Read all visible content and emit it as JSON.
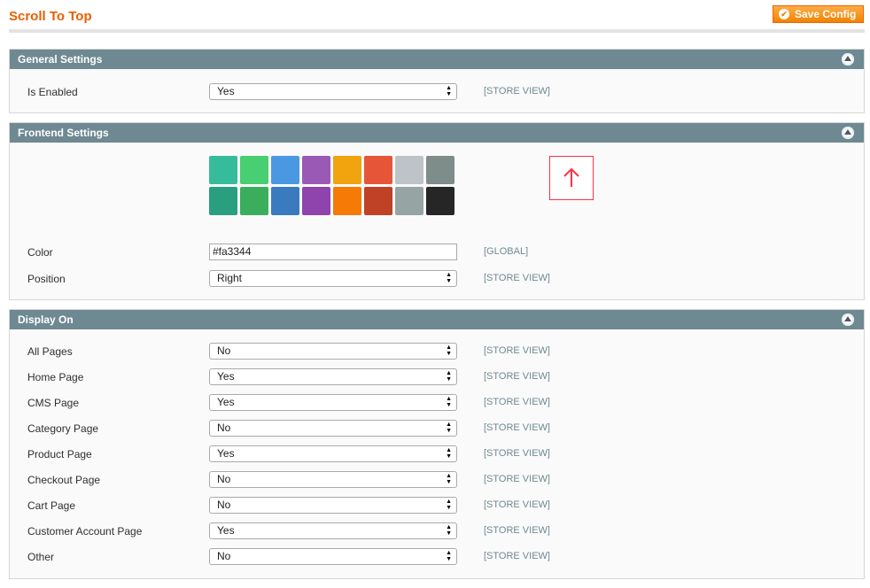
{
  "page": {
    "title": "Scroll To Top",
    "save_button": "Save Config"
  },
  "general": {
    "title": "General Settings",
    "is_enabled": {
      "label": "Is Enabled",
      "value": "Yes",
      "scope": "[STORE VIEW]"
    }
  },
  "frontend": {
    "title": "Frontend Settings",
    "swatches": [
      "#36bc9b",
      "#48cf71",
      "#4b98e2",
      "#9b59b6",
      "#f1a40d",
      "#e65538",
      "#bdc3c7",
      "#7e8c8a",
      "#2a9f80",
      "#3bae5e",
      "#397bbe",
      "#8f44ad",
      "#f57b06",
      "#bf4126",
      "#96a5a4",
      "#262626"
    ],
    "preview_color": "#fa3344",
    "color": {
      "label": "Color",
      "value": "#fa3344",
      "scope": "[GLOBAL]"
    },
    "position": {
      "label": "Position",
      "value": "Right",
      "scope": "[STORE VIEW]"
    }
  },
  "display_on": {
    "title": "Display On",
    "rows": [
      {
        "label": "All Pages",
        "value": "No",
        "scope": "[STORE VIEW]"
      },
      {
        "label": "Home Page",
        "value": "Yes",
        "scope": "[STORE VIEW]"
      },
      {
        "label": "CMS Page",
        "value": "Yes",
        "scope": "[STORE VIEW]"
      },
      {
        "label": "Category Page",
        "value": "No",
        "scope": "[STORE VIEW]"
      },
      {
        "label": "Product Page",
        "value": "Yes",
        "scope": "[STORE VIEW]"
      },
      {
        "label": "Checkout Page",
        "value": "No",
        "scope": "[STORE VIEW]"
      },
      {
        "label": "Cart Page",
        "value": "No",
        "scope": "[STORE VIEW]"
      },
      {
        "label": "Customer Account Page",
        "value": "Yes",
        "scope": "[STORE VIEW]"
      },
      {
        "label": "Other",
        "value": "No",
        "scope": "[STORE VIEW]"
      }
    ]
  },
  "icons": {
    "save": "checkmark-circle-icon",
    "collapse": "collapse-up-icon",
    "select": "select-updown-arrows-icon",
    "preview": "arrow-up-icon"
  }
}
